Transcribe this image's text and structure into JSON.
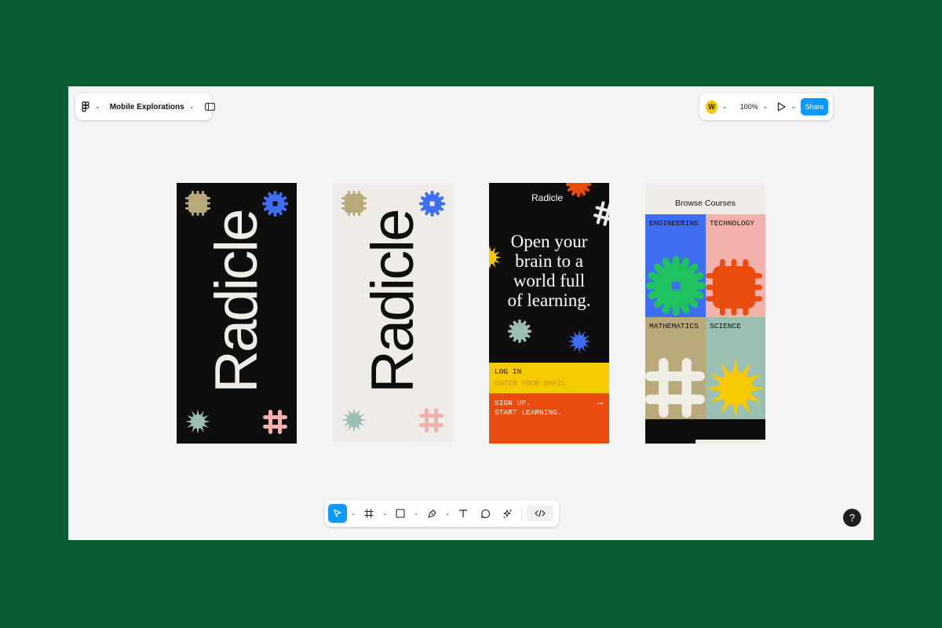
{
  "header": {
    "file_name": "Mobile Explorations",
    "user_initial": "W",
    "zoom": "100%",
    "share_label": "Share"
  },
  "frames": {
    "dark_logo": {
      "wordmark": "Radicle"
    },
    "light_logo": {
      "wordmark": "Radicle"
    },
    "login": {
      "logo": "Radicle",
      "headline": [
        "Open your",
        "brain to a",
        "world full",
        "of learning."
      ],
      "login_label": "LOG IN",
      "email_placeholder": "ENTER YOUR EMAIL",
      "signup_line1": "SIGN UP.",
      "signup_line2": "START LEARNING.",
      "arrow": "→"
    },
    "courses": {
      "title": "Browse Courses",
      "categories": [
        "ENGINEERING",
        "TECHNOLOGY",
        "MATHEMATICS",
        "SCIENCE"
      ]
    }
  },
  "help_label": "?",
  "colors": {
    "background": "#0b5e33",
    "canvas": "#f4f4f4",
    "accent": "#0d99ff",
    "blue": "#3f6ff0",
    "green": "#1fc35e",
    "orange": "#ea4c0f",
    "yellow": "#f6c900",
    "sage": "#9bbfb1",
    "khaki": "#b8a97a",
    "pink": "#f2b1aa"
  },
  "icons": [
    "figma-menu-icon",
    "sidebar-toggle-icon",
    "present-icon",
    "move-tool-icon",
    "frame-tool-icon",
    "rectangle-tool-icon",
    "pen-tool-icon",
    "text-tool-icon",
    "comment-tool-icon",
    "actions-tool-icon",
    "dev-mode-icon"
  ]
}
